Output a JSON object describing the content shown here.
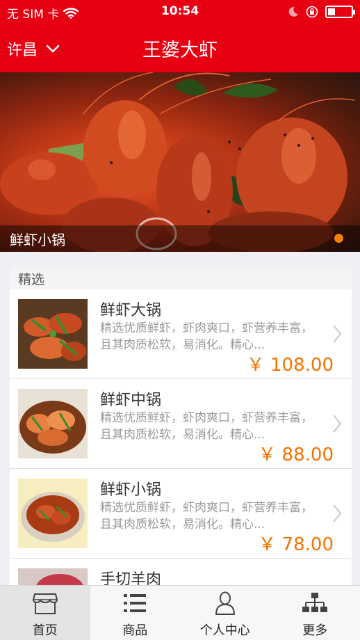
{
  "status_bar": {
    "carrier": "无 SIM 卡",
    "time": "10:54",
    "battery_level": 0.3
  },
  "nav": {
    "city": "许昌",
    "title": "王婆大虾"
  },
  "banner": {
    "caption": "鲜虾小锅",
    "active_index": 0,
    "slide_count": 1
  },
  "featured": {
    "header": "精选",
    "items": [
      {
        "name": "鲜虾大锅",
        "desc": "精选优质鲜虾，虾肉爽口，虾营养丰富，且其肉质松软，易消化。精心...",
        "price": "￥ 108.00"
      },
      {
        "name": "鲜虾中锅",
        "desc": "精选优质鲜虾，虾肉爽口，虾营养丰富，且其肉质松软，易消化。精心...",
        "price": "￥ 88.00"
      },
      {
        "name": "鲜虾小锅",
        "desc": "精选优质鲜虾，虾肉爽口，虾营养丰富，且其肉质松软，易消化。精心...",
        "price": "￥ 78.00"
      },
      {
        "name": "手切羊肉",
        "desc": "",
        "price": ""
      }
    ]
  },
  "tabs": [
    {
      "label": "首页",
      "icon": "store-icon",
      "active": true
    },
    {
      "label": "商品",
      "icon": "list-icon",
      "active": false
    },
    {
      "label": "个人中心",
      "icon": "person-icon",
      "active": false
    },
    {
      "label": "更多",
      "icon": "sitemap-icon",
      "active": false
    }
  ],
  "colors": {
    "brand_red": "#e60012",
    "price_orange": "#f57300",
    "dot_orange": "#f08300"
  }
}
